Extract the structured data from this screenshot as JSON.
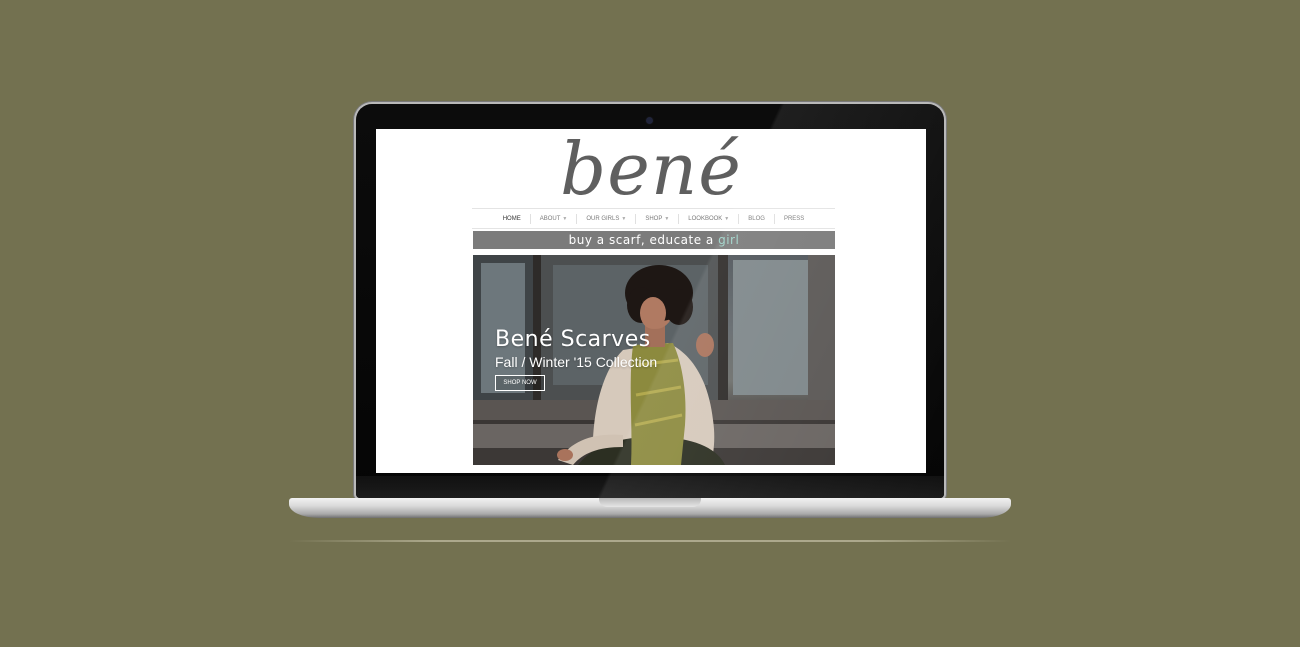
{
  "site": {
    "logo": "bené",
    "nav": [
      {
        "label": "HOME",
        "dropdown": false,
        "active": true
      },
      {
        "label": "ABOUT",
        "dropdown": true,
        "active": false
      },
      {
        "label": "OUR GIRLS",
        "dropdown": true,
        "active": false
      },
      {
        "label": "SHOP",
        "dropdown": true,
        "active": false
      },
      {
        "label": "LOOKBOOK",
        "dropdown": true,
        "active": false
      },
      {
        "label": "BLOG",
        "dropdown": false,
        "active": false
      },
      {
        "label": "PRESS",
        "dropdown": false,
        "active": false
      }
    ],
    "banner": {
      "text": "buy a scarf, educate a ",
      "accent": "girl"
    },
    "hero": {
      "title": "Bené Scarves",
      "subtitle": "Fall / Winter '15 Collection",
      "button_label": "SHOP NOW"
    }
  },
  "colors": {
    "background": "#737150",
    "banner": "#7b7b7b",
    "accent": "#9fd3c9",
    "logo": "#5f5f5f"
  },
  "icons": {
    "dropdown": "chevron-down-icon"
  }
}
